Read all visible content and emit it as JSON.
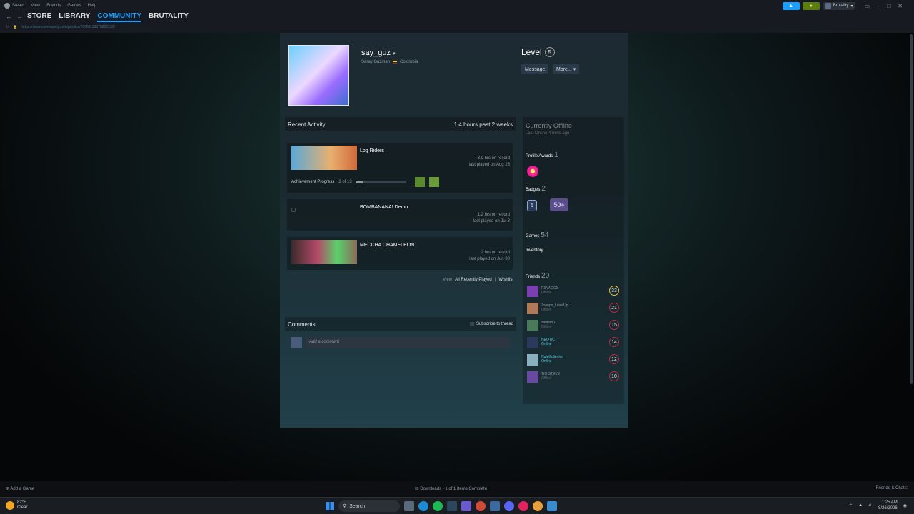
{
  "menubar": {
    "items": [
      "Steam",
      "View",
      "Friends",
      "Games",
      "Help"
    ]
  },
  "account": {
    "name": "Brutality"
  },
  "nav": {
    "links": [
      "STORE",
      "LIBRARY",
      "COMMUNITY",
      "BRUTALITY"
    ],
    "active": "COMMUNITY",
    "url": "https://steamcommunity.com/profiles/76561199078822239/"
  },
  "profile": {
    "name": "say_guz",
    "real_name": "Saray Guzman",
    "country": "Colombia",
    "level_label": "Level",
    "level": "5",
    "message_button": "Message",
    "more_button": "More..."
  },
  "recent": {
    "title": "Recent Activity",
    "hours": "1.4 hours past 2 weeks",
    "games": [
      {
        "title": "Log Riders",
        "hrs": "3.9 hrs on record",
        "last": "last played on Aug 26",
        "ach_label": "Achievement Progress",
        "ach_count": "2 of 13",
        "ach_progress": 0.15
      },
      {
        "title": "BOMBANANA! Demo",
        "hrs": "1.2 hrs on record",
        "last": "last played on Jul 3"
      },
      {
        "title": "MECCHA CHAMELEON",
        "hrs": "2 hrs on record",
        "last": "last played on Jun 30"
      }
    ],
    "view": "View",
    "all_recent": "All Recently Played",
    "wishlist": "Wishlist"
  },
  "comments": {
    "title": "Comments",
    "subscribe": "Subscribe to thread",
    "placeholder": "Add a comment"
  },
  "side": {
    "status": "Currently Offline",
    "last_online": "Last Online 4 mins ago",
    "awards_label": "Profile Awards",
    "awards_count": "1",
    "badges_label": "Badges",
    "badges_count": "2",
    "badge1": "6",
    "badge2": "50+",
    "games_label": "Games",
    "games_count": "54",
    "inventory_label": "Inventory",
    "friends_label": "Friends",
    "friends_count": "20",
    "friends": [
      {
        "name": "P3NAGOS",
        "status": "Offline",
        "level": "33",
        "online": false,
        "color": "#7a3fb0"
      },
      {
        "name": "Joanpo_LevelUp",
        "status": "Offline",
        "level": "21",
        "online": false,
        "color": "#b07a5a"
      },
      {
        "name": "zaritsthu",
        "status": "Offline",
        "level": "15",
        "online": false,
        "color": "#4a7a5a"
      },
      {
        "name": "NEOTIC",
        "status": "Online",
        "level": "14",
        "online": true,
        "color": "#2a3a5a"
      },
      {
        "name": "NutellaSenior",
        "status": "Online",
        "level": "12",
        "online": true,
        "color": "#8ab0c0"
      },
      {
        "name": "TIO STEVE",
        "status": "Offline",
        "level": "10",
        "online": false,
        "color": "#6a4aa0"
      }
    ]
  },
  "bottom": {
    "add_game": "Add a Game",
    "downloads": "Downloads - 1 of 1 Items Complete",
    "friends_chat": "Friends & Chat"
  },
  "taskbar": {
    "temp": "82°F",
    "weather": "Clear",
    "search": "Search",
    "time": "1:25 AM",
    "date": "8/26/2026"
  }
}
